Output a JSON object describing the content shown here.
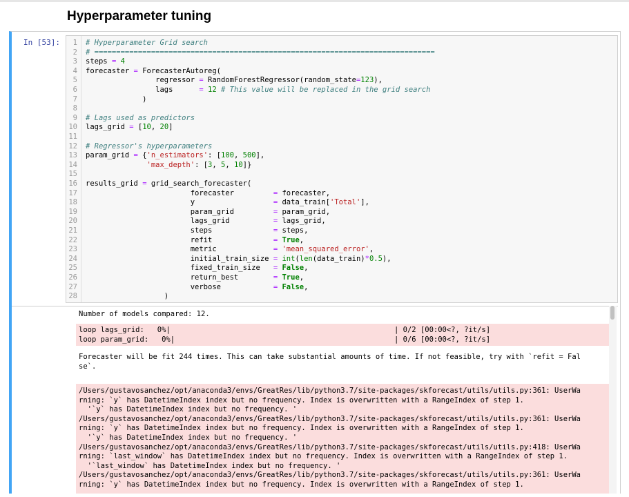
{
  "heading": "Hyperparameter tuning",
  "cell": {
    "prompt": "In [53]:",
    "code_lines": [
      [
        {
          "t": "# Hyperparameter Grid search",
          "c": "cm"
        }
      ],
      [
        {
          "t": "# ==============================================================================",
          "c": "cm"
        }
      ],
      [
        {
          "t": "steps "
        },
        {
          "t": "=",
          "c": "op"
        },
        {
          "t": " "
        },
        {
          "t": "4",
          "c": "nu"
        }
      ],
      [
        {
          "t": "forecaster "
        },
        {
          "t": "=",
          "c": "op"
        },
        {
          "t": " ForecasterAutoreg("
        }
      ],
      [
        {
          "t": "                regressor "
        },
        {
          "t": "=",
          "c": "op"
        },
        {
          "t": " RandomForestRegressor(random_state"
        },
        {
          "t": "=",
          "c": "op"
        },
        {
          "t": "123",
          "c": "nu"
        },
        {
          "t": "),"
        }
      ],
      [
        {
          "t": "                lags      "
        },
        {
          "t": "=",
          "c": "op"
        },
        {
          "t": " "
        },
        {
          "t": "12",
          "c": "nu"
        },
        {
          "t": " "
        },
        {
          "t": "# This value will be replaced in the grid search",
          "c": "cm"
        }
      ],
      [
        {
          "t": "             )"
        }
      ],
      [],
      [
        {
          "t": "# Lags used as predictors",
          "c": "cm"
        }
      ],
      [
        {
          "t": "lags_grid "
        },
        {
          "t": "=",
          "c": "op"
        },
        {
          "t": " ["
        },
        {
          "t": "10",
          "c": "nu"
        },
        {
          "t": ", "
        },
        {
          "t": "20",
          "c": "nu"
        },
        {
          "t": "]"
        }
      ],
      [],
      [
        {
          "t": "# Regressor's hyperparameters",
          "c": "cm"
        }
      ],
      [
        {
          "t": "param_grid "
        },
        {
          "t": "=",
          "c": "op"
        },
        {
          "t": " {"
        },
        {
          "t": "'n_estimators'",
          "c": "st"
        },
        {
          "t": ": ["
        },
        {
          "t": "100",
          "c": "nu"
        },
        {
          "t": ", "
        },
        {
          "t": "500",
          "c": "nu"
        },
        {
          "t": "],"
        }
      ],
      [
        {
          "t": "              "
        },
        {
          "t": "'max_depth'",
          "c": "st"
        },
        {
          "t": ": ["
        },
        {
          "t": "3",
          "c": "nu"
        },
        {
          "t": ", "
        },
        {
          "t": "5",
          "c": "nu"
        },
        {
          "t": ", "
        },
        {
          "t": "10",
          "c": "nu"
        },
        {
          "t": "]}"
        }
      ],
      [],
      [
        {
          "t": "results_grid "
        },
        {
          "t": "=",
          "c": "op"
        },
        {
          "t": " grid_search_forecaster("
        }
      ],
      [
        {
          "t": "                        forecaster         "
        },
        {
          "t": "=",
          "c": "op"
        },
        {
          "t": " forecaster,"
        }
      ],
      [
        {
          "t": "                        y                  "
        },
        {
          "t": "=",
          "c": "op"
        },
        {
          "t": " data_train["
        },
        {
          "t": "'Total'",
          "c": "st"
        },
        {
          "t": "],"
        }
      ],
      [
        {
          "t": "                        param_grid         "
        },
        {
          "t": "=",
          "c": "op"
        },
        {
          "t": " param_grid,"
        }
      ],
      [
        {
          "t": "                        lags_grid          "
        },
        {
          "t": "=",
          "c": "op"
        },
        {
          "t": " lags_grid,"
        }
      ],
      [
        {
          "t": "                        steps              "
        },
        {
          "t": "=",
          "c": "op"
        },
        {
          "t": " steps,"
        }
      ],
      [
        {
          "t": "                        refit              "
        },
        {
          "t": "=",
          "c": "op"
        },
        {
          "t": " "
        },
        {
          "t": "True",
          "c": "kw"
        },
        {
          "t": ","
        }
      ],
      [
        {
          "t": "                        metric             "
        },
        {
          "t": "=",
          "c": "op"
        },
        {
          "t": " "
        },
        {
          "t": "'mean_squared_error'",
          "c": "st"
        },
        {
          "t": ","
        }
      ],
      [
        {
          "t": "                        initial_train_size "
        },
        {
          "t": "=",
          "c": "op"
        },
        {
          "t": " "
        },
        {
          "t": "int",
          "c": "nu"
        },
        {
          "t": "("
        },
        {
          "t": "len",
          "c": "nu"
        },
        {
          "t": "(data_train)"
        },
        {
          "t": "*",
          "c": "op"
        },
        {
          "t": "0.5",
          "c": "nu"
        },
        {
          "t": "),"
        }
      ],
      [
        {
          "t": "                        fixed_train_size   "
        },
        {
          "t": "=",
          "c": "op"
        },
        {
          "t": " "
        },
        {
          "t": "False",
          "c": "kw"
        },
        {
          "t": ","
        }
      ],
      [
        {
          "t": "                        return_best        "
        },
        {
          "t": "=",
          "c": "op"
        },
        {
          "t": " "
        },
        {
          "t": "True",
          "c": "kw"
        },
        {
          "t": ","
        }
      ],
      [
        {
          "t": "                        verbose            "
        },
        {
          "t": "=",
          "c": "op"
        },
        {
          "t": " "
        },
        {
          "t": "False",
          "c": "kw"
        },
        {
          "t": ","
        }
      ],
      [
        {
          "t": "                  )"
        }
      ]
    ]
  },
  "output": {
    "models_compared": "Number of models compared: 12.",
    "progress": [
      {
        "left": "loop lags_grid:   0%|",
        "right": "| 0/2 [00:00<?, ?it/s]"
      },
      {
        "left": "loop param_grid:   0%|",
        "right": "| 0/6 [00:00<?, ?it/s]"
      }
    ],
    "fit_message": [
      "Forecaster will be fit 244 times. This can take substantial amounts of time. If not feasible, try with `refit = Fal",
      "se`."
    ],
    "warnings": [
      "/Users/gustavosanchez/opt/anaconda3/envs/GreatRes/lib/python3.7/site-packages/skforecast/utils/utils.py:361: UserWa",
      "rning: `y` has DatetimeIndex index but no frequency. Index is overwritten with a RangeIndex of step 1.",
      "  '`y` has DatetimeIndex index but no frequency. '",
      "/Users/gustavosanchez/opt/anaconda3/envs/GreatRes/lib/python3.7/site-packages/skforecast/utils/utils.py:361: UserWa",
      "rning: `y` has DatetimeIndex index but no frequency. Index is overwritten with a RangeIndex of step 1.",
      "  '`y` has DatetimeIndex index but no frequency. '",
      "/Users/gustavosanchez/opt/anaconda3/envs/GreatRes/lib/python3.7/site-packages/skforecast/utils/utils.py:418: UserWa",
      "rning: `last_window` has DatetimeIndex index but no frequency. Index is overwritten with a RangeIndex of step 1.",
      "  '`last_window` has DatetimeIndex index but no frequency. '",
      "/Users/gustavosanchez/opt/anaconda3/envs/GreatRes/lib/python3.7/site-packages/skforecast/utils/utils.py:361: UserWa",
      "rning: `y` has DatetimeIndex index but no frequency. Index is overwritten with a RangeIndex of step 1."
    ]
  }
}
